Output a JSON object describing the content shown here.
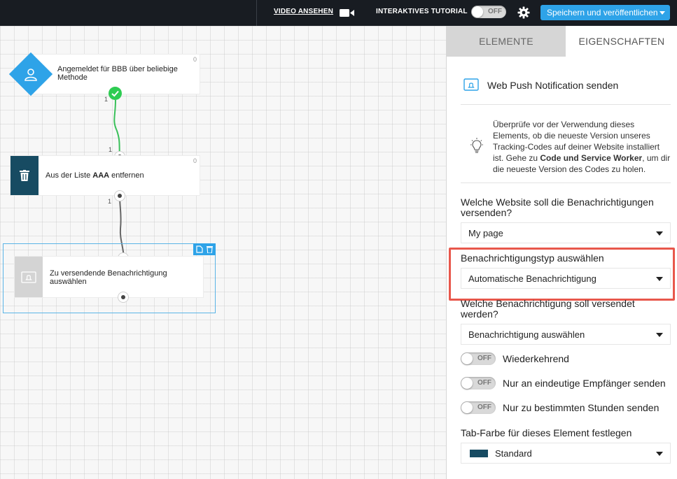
{
  "topbar": {
    "video_label": "VIDEO ANSEHEN",
    "tutorial_label": "INTERAKTIVES TUTORIAL",
    "tutorial_toggle": "OFF",
    "publish_label": "Speichern und veröffentlichen"
  },
  "canvas": {
    "node1": {
      "label": "Angemeldet für BBB über beliebige Methode",
      "count": "0"
    },
    "conn1_out": "1",
    "conn1_in": "1",
    "node2": {
      "label_prefix": "Aus der Liste ",
      "label_bold": "AAA",
      "label_suffix": " entfernen",
      "count": "0"
    },
    "conn2_out": "1",
    "node3": {
      "label": "Zu versendende Benachrichtigung auswählen"
    }
  },
  "panel": {
    "tabs": [
      "ELEMENTE",
      "EIGENSCHAFTEN"
    ],
    "title": "Web Push Notification senden",
    "info": {
      "text_1": "Überprüfe vor der Verwendung dieses Elements, ob die neueste Version unseres Tracking-Codes auf deiner Website installiert ist. Gehe zu ",
      "text_bold": "Code und Service Worker",
      "text_2": ", um dir die neueste Version des Codes zu holen."
    },
    "website": {
      "label": "Welche Website soll die Benachrichtigungen versenden?",
      "value": "My page"
    },
    "type": {
      "label": "Benachrichtigungstyp auswählen",
      "value": "Automatische Benachrichtigung"
    },
    "notification": {
      "label": "Welche Benachrichtigung soll versendet werden?",
      "value": "Benachrichtigung auswählen"
    },
    "options": [
      {
        "label": "Wiederkehrend",
        "state": "OFF"
      },
      {
        "label": "Nur an eindeutige Empfänger senden",
        "state": "OFF"
      },
      {
        "label": "Nur zu bestimmten Stunden senden",
        "state": "OFF"
      }
    ],
    "tab_color": {
      "label": "Tab-Farbe für dieses Element festlegen",
      "value": "Standard",
      "swatch": "#174b62"
    }
  },
  "colors": {
    "accent": "#2ea3e8",
    "success": "#2ecc52",
    "highlight": "#e8574b",
    "dark_node": "#174b62"
  }
}
